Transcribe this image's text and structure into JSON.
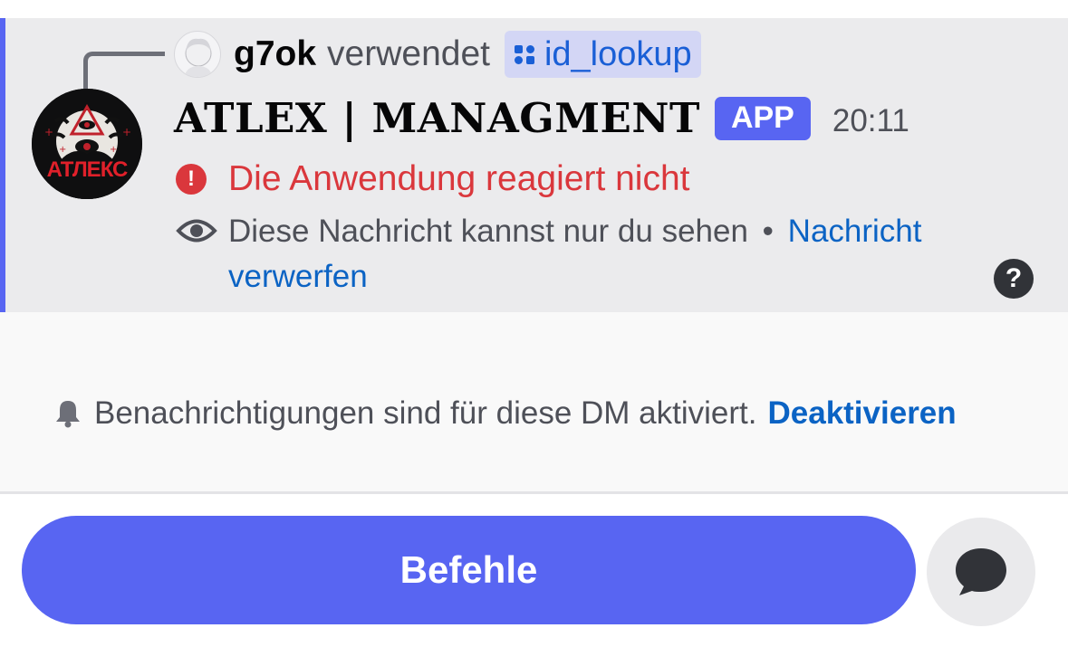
{
  "message": {
    "reply": {
      "user": "g7ok",
      "verb": "verwendet",
      "command": "id_lookup"
    },
    "bot": {
      "name": "ATLEX | MANAGMENT",
      "badge": "APP",
      "timestamp": "20:11",
      "avatar_text": "АТЛЕКС"
    },
    "error_text": "Die Anwendung reagiert nicht",
    "ephemeral": {
      "text": "Diese Nachricht kannst nur du sehen",
      "separator": "•",
      "link_line1": "Nachricht",
      "link_line2": "verwerfen"
    },
    "help_symbol": "?"
  },
  "notice": {
    "text": "Benachrichtigungen sind für diese DM aktiviert.",
    "link": "Deaktivieren"
  },
  "footer": {
    "commands_button": "Befehle"
  },
  "colors": {
    "accent": "#5865f2",
    "error": "#da373c",
    "link": "#0b63c4",
    "message_bg": "#ebebed"
  },
  "icons": [
    "eye-icon",
    "bell-icon",
    "chat-bubble-icon",
    "command-icon",
    "alert-icon",
    "help-icon"
  ]
}
